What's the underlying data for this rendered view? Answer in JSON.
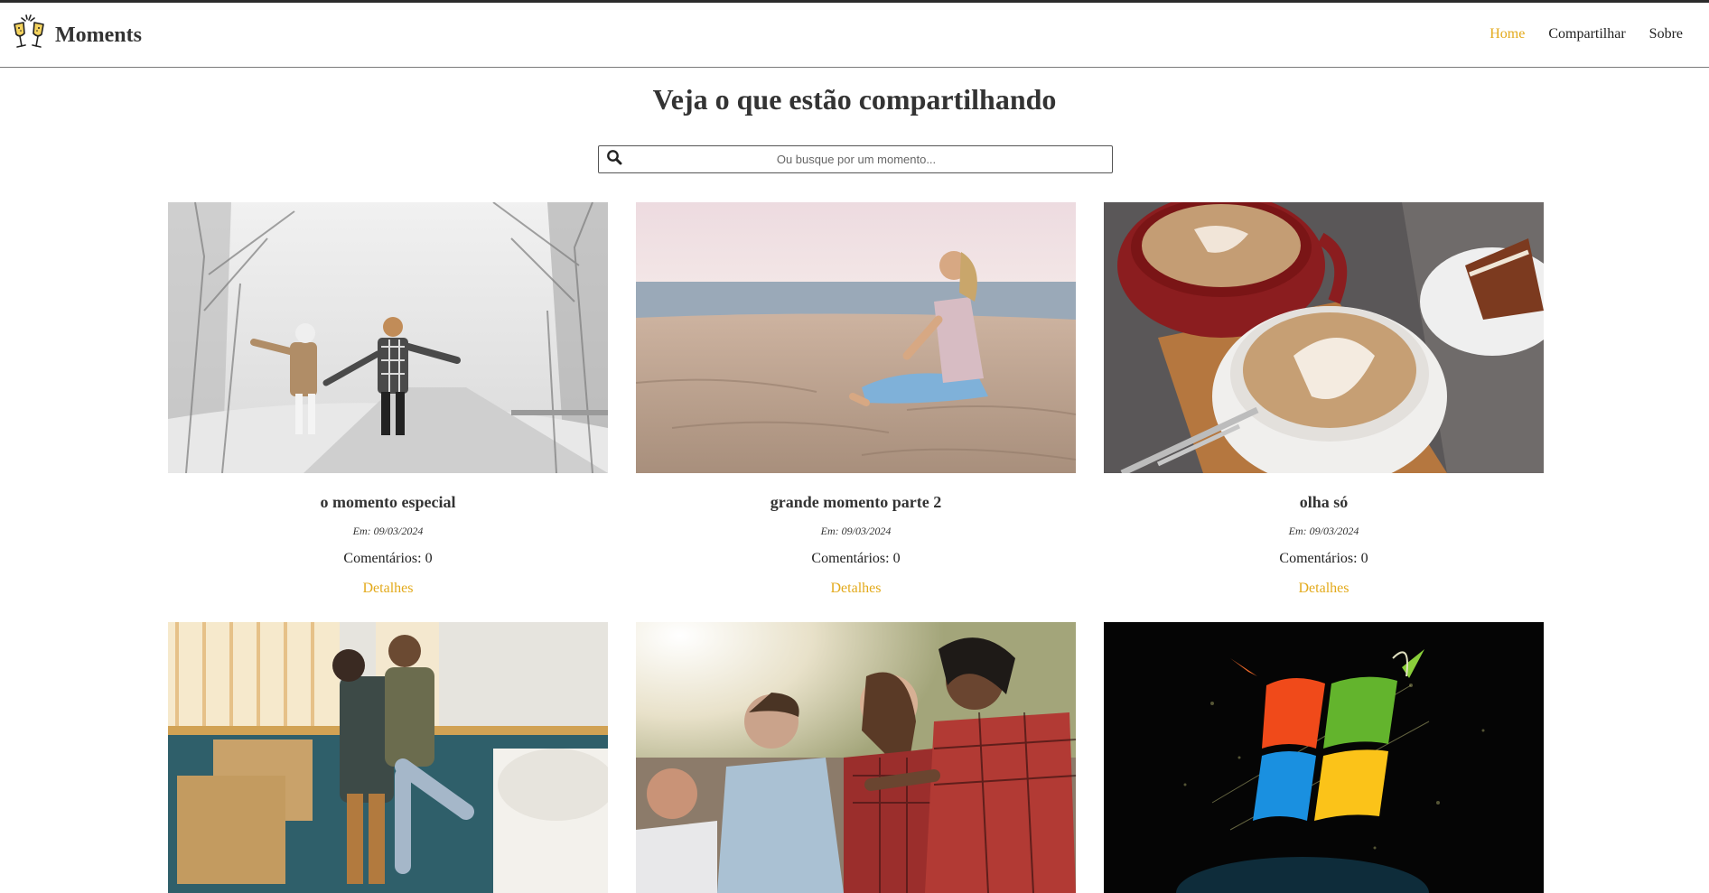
{
  "header": {
    "brand": "Moments",
    "nav": [
      {
        "label": "Home",
        "active": true
      },
      {
        "label": "Compartilhar",
        "active": false
      },
      {
        "label": "Sobre",
        "active": false
      }
    ]
  },
  "main": {
    "title": "Veja o que estão compartilhando",
    "search": {
      "placeholder": "Ou busque por um momento...",
      "value": ""
    }
  },
  "moments": [
    {
      "title": "o momento especial",
      "date": "Em: 09/03/2024",
      "comments": "Comentários: 0",
      "details": "Detalhes",
      "image": "couple-snow-forest"
    },
    {
      "title": "grande momento parte 2",
      "date": "Em: 09/03/2024",
      "comments": "Comentários: 0",
      "details": "Detalhes",
      "image": "woman-sitting-beach"
    },
    {
      "title": "olha só",
      "date": "Em: 09/03/2024",
      "comments": "Comentários: 0",
      "details": "Detalhes",
      "image": "latte-coffee-cups"
    },
    {
      "image": "couple-hug-new-home"
    },
    {
      "image": "friends-laughing-outdoors"
    },
    {
      "image": "windows-logo-burst"
    }
  ],
  "colors": {
    "accent": "#e3aa1c",
    "text": "#333333",
    "header_border": "#7a7a7a"
  }
}
